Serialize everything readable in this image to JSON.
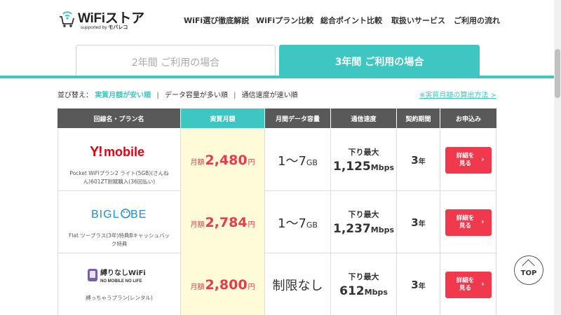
{
  "header": {
    "logo_text": "WiFiストア",
    "logo_sub_prefix": "supported by",
    "logo_sub_brand": "モバレコ",
    "nav": [
      "WiFi選び徹底解説",
      "WiFiプラン比較",
      "総合ポイント比較",
      "取扱いサービス",
      "ご利用の流れ"
    ]
  },
  "tabs": {
    "two_year": "2年間 ご利用の場合",
    "three_year": "3年間 ご利用の場合"
  },
  "sort": {
    "label": "並び替え：",
    "options": [
      "実質月額が安い順",
      "データ容量が多い順",
      "通信速度が速い順"
    ],
    "calc_link": "※実質月額の算出方法 >"
  },
  "table": {
    "headers": [
      "回線名・プラン名",
      "実質月額",
      "月間データ容量",
      "通信速度",
      "契約期間",
      "お申込み"
    ],
    "rows": [
      {
        "brand": "Y!mobile",
        "plan": "Pocket WiFiプラン2 ライト(5GB)(さんねん)601ZT割賦購入(36回払い)",
        "price_prefix": "月額",
        "price": "2,480",
        "price_unit": "円",
        "data": "1〜7",
        "data_unit": "GB",
        "speed_label": "下り最大",
        "speed": "1,125",
        "speed_unit": "Mbps",
        "term": "3",
        "term_unit": "年",
        "apply": "詳細を見る"
      },
      {
        "brand": "BIGLOBE",
        "plan": "Flat ツープラス(3年)特典Bキャッシュバック特典",
        "price_prefix": "月額",
        "price": "2,784",
        "price_unit": "円",
        "data": "1〜7",
        "data_unit": "GB",
        "speed_label": "下り最大",
        "speed": "1,237",
        "speed_unit": "Mbps",
        "term": "3",
        "term_unit": "年",
        "apply": "詳細を見る"
      },
      {
        "brand": "縛りなしWiFi",
        "brand_sub": "NO MOBILE NO LIFE",
        "plan": "縛っちゃうプラン(レンタル)",
        "price_prefix": "月額",
        "price": "2,800",
        "price_unit": "円",
        "data": "制限なし",
        "data_unit": "",
        "speed_label": "下り最大",
        "speed": "612",
        "speed_unit": "Mbps",
        "term": "3",
        "term_unit": "年",
        "apply": "詳細を見る"
      }
    ]
  },
  "top_button": "TOP",
  "colors": {
    "accent": "#3ec7c2",
    "price": "#e63c4b",
    "button": "#f0394c",
    "header_dark": "#595959",
    "price_bg": "#fefbd8"
  }
}
